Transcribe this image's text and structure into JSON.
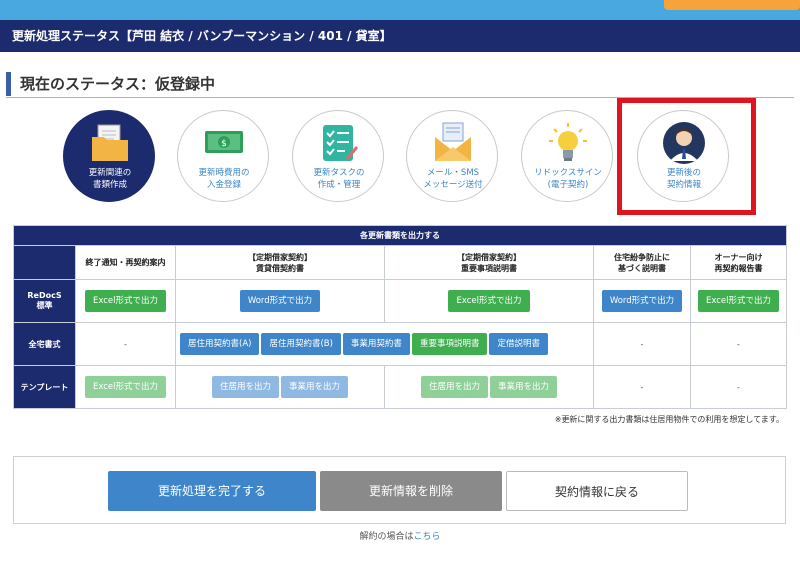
{
  "page_title": "更新処理ステータス【芦田 結衣 / バンブーマンション / 401 / 貸室】",
  "status_heading": "現在のステータス：仮登録中",
  "steps": [
    {
      "label_line1": "更新関連の",
      "label_line2": "書類作成",
      "icon": "document-folder-icon",
      "active": true
    },
    {
      "label_line1": "更新時費用の",
      "label_line2": "入金登録",
      "icon": "money-icon",
      "active": false
    },
    {
      "label_line1": "更新タスクの",
      "label_line2": "作成・管理",
      "icon": "checklist-icon",
      "active": false
    },
    {
      "label_line1": "メール・SMS",
      "label_line2": "メッセージ送付",
      "icon": "mail-icon",
      "active": false
    },
    {
      "label_line1": "リドックスサイン",
      "label_line2": "(電子契約)",
      "icon": "lightbulb-icon",
      "active": false
    },
    {
      "label_line1": "更新後の",
      "label_line2": "契約情報",
      "icon": "person-icon",
      "active": false
    }
  ],
  "table": {
    "title": "各更新書類を出力する",
    "col_headers": [
      {
        "line1": "終了通知・再契約案内",
        "line2": ""
      },
      {
        "line1": "【定期借家契約】",
        "line2": "賃貸借契約書"
      },
      {
        "line1": "【定期借家契約】",
        "line2": "重要事項説明書"
      },
      {
        "line1": "住宅紛争防止に",
        "line2": "基づく説明書"
      },
      {
        "line1": "オーナー向け",
        "line2": "再契約報告書"
      }
    ],
    "rows": [
      {
        "header_line1": "ReDocS",
        "header_line2": "標準",
        "c1": "Excel形式で出力",
        "c2": "Word形式で出力",
        "c3": "Excel形式で出力",
        "c4": "Word形式で出力",
        "c5": "Excel形式で出力"
      },
      {
        "header": "全宅書式",
        "c1": "-",
        "c2a": "居住用契約書(A)",
        "c2b": "居住用契約書(B)",
        "c2c": "事業用契約書",
        "c3a": "重要事項説明書",
        "c3b": "定借説明書",
        "c4": "-",
        "c5": "-"
      },
      {
        "header": "テンプレート",
        "c1": "Excel形式で出力",
        "c2a": "住居用を出力",
        "c2b": "事業用を出力",
        "c3a": "住居用を出力",
        "c3b": "事業用を出力",
        "c4": "-",
        "c5": "-"
      }
    ]
  },
  "note": "※更新に関する出力書類は住居用物件での利用を想定してます。",
  "actions": {
    "complete": "更新処理を完了する",
    "delete": "更新情報を削除",
    "back": "契約情報に戻る"
  },
  "footer": {
    "prefix": "解約の場合は",
    "link": "こちら"
  },
  "colors": {
    "navy": "#1c2a6e",
    "topbar": "#4aa8e0",
    "green": "#3fae4f",
    "blue": "#3e86c9",
    "highlight": "#e0141c"
  }
}
